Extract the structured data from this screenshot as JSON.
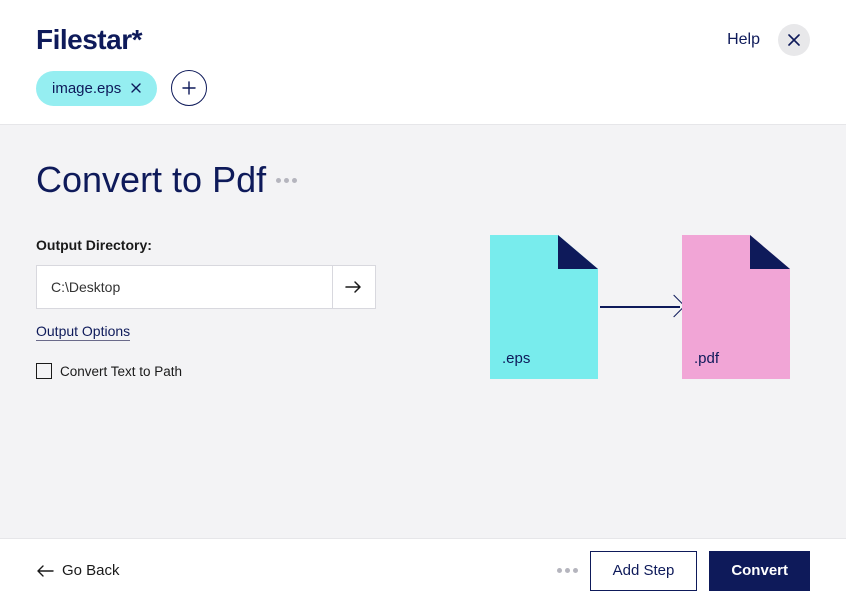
{
  "header": {
    "logo": "Filestar*",
    "help_label": "Help"
  },
  "file": {
    "name": "image.eps"
  },
  "page": {
    "title": "Convert to Pdf"
  },
  "output": {
    "label": "Output Directory:",
    "path": "C:\\Desktop",
    "options_link": "Output Options",
    "convert_text_label": "Convert Text to Path",
    "convert_text_checked": false
  },
  "illustration": {
    "from_ext": ".eps",
    "to_ext": ".pdf"
  },
  "footer": {
    "goback_label": "Go Back",
    "addstep_label": "Add Step",
    "convert_label": "Convert"
  }
}
